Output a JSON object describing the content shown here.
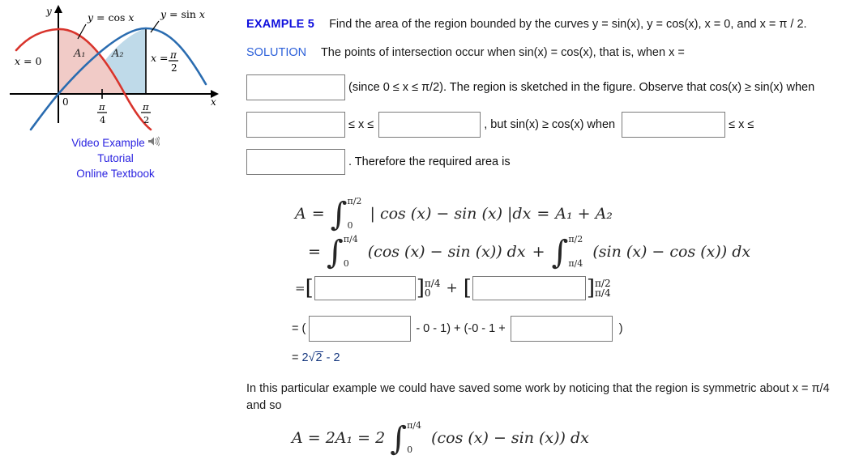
{
  "figure": {
    "axis_labels": {
      "y": "y",
      "x": "x",
      "origin": "0"
    },
    "tick_labels": [
      {
        "num": "π",
        "den": "4"
      },
      {
        "num": "π",
        "den": "2"
      }
    ],
    "curve_labels": [
      {
        "id": "cos-curve-label",
        "text": "y = cos x",
        "color": "#d8342c"
      },
      {
        "id": "sin-curve-label",
        "text": "y = sin x",
        "color": "#2a6cb0"
      }
    ],
    "region_labels": [
      {
        "id": "region-a1",
        "text": "A₁"
      },
      {
        "id": "region-a2",
        "text": "A₂"
      }
    ],
    "boundary_left": "x = 0",
    "boundary_right_lhs": "x =",
    "boundary_right_num": "π",
    "boundary_right_den": "2",
    "colors": {
      "cos_curve": "#d8342c",
      "sin_curve": "#2a6cb0",
      "region_a1_fill": "#f0c8c4",
      "region_a2_fill": "#bcd8e8",
      "axis": "#000000",
      "link": "#2a22e0"
    },
    "links": [
      {
        "id": "video-example",
        "label": "Video Example",
        "icon": "speaker-icon"
      },
      {
        "id": "tutorial",
        "label": "Tutorial",
        "icon": null
      },
      {
        "id": "online-textbook",
        "label": "Online Textbook",
        "icon": null
      }
    ]
  },
  "example": {
    "label": "EXAMPLE 5",
    "prompt": "Find the area of the region bounded by the curves y = sin(x), y = cos(x), x = 0, and x = π / 2."
  },
  "solution": {
    "label": "SOLUTION",
    "line1": "The points of intersection occur when sin(x) = cos(x), that is, when x =",
    "after_box1": "(since 0 ≤ x ≤ π/2). The region is sketched in the figure. Observe that cos(x) ≥ sin(x) when",
    "between_box2_box3": "≤ x ≤",
    "after_box3": ", but sin(x) ≥ cos(x) when",
    "after_box4": "≤ x ≤",
    "after_box5": ". Therefore the required area is"
  },
  "inputs": {
    "box1": {
      "name": "answer-box-1",
      "value": "",
      "placeholder": ""
    },
    "box2": {
      "name": "answer-box-2",
      "value": "",
      "placeholder": ""
    },
    "box3": {
      "name": "answer-box-3",
      "value": "",
      "placeholder": ""
    },
    "box4": {
      "name": "answer-box-4",
      "value": "",
      "placeholder": ""
    },
    "box5": {
      "name": "answer-box-5",
      "value": "",
      "placeholder": ""
    },
    "box6": {
      "name": "antiderivative-box-1",
      "value": "",
      "placeholder": ""
    },
    "box7": {
      "name": "antiderivative-box-2",
      "value": "",
      "placeholder": ""
    },
    "box8": {
      "name": "evaluation-box-1",
      "value": "",
      "placeholder": ""
    },
    "box9": {
      "name": "evaluation-box-2",
      "value": "",
      "placeholder": ""
    }
  },
  "math": {
    "eq1": {
      "lhs": "A",
      "eq": "=",
      "upper": "π/2",
      "lower": "0",
      "integrand": "| cos (x) − sin (x) |dx",
      "tail_eq": "=",
      "tail": "A₁ + A₂"
    },
    "eq2": {
      "eq": "=",
      "int1": {
        "upper": "π/4",
        "lower": "0",
        "integrand": "(cos (x) − sin (x)) dx"
      },
      "plus": "+",
      "int2": {
        "upper": "π/2",
        "lower": "π/4",
        "integrand": "(sin (x) − cos (x)) dx"
      }
    },
    "eq3": {
      "eq": "=",
      "open1": "[",
      "close1": "]",
      "lim1_top": "π/4",
      "lim1_bot": "0",
      "plus": "+",
      "open2": "[",
      "close2": "]",
      "lim2_top": "π/2",
      "lim2_bot": "π/4"
    },
    "eq4": {
      "eq": "= (",
      "mid": "- 0 - 1) + (-0 - 1 +",
      "close": ")"
    },
    "eq5": {
      "eq": "=",
      "coef": "2",
      "radicand": "2",
      "tail": "- 2"
    },
    "eq6": {
      "lhs": "A = 2A₁ = 2",
      "upper": "π/4",
      "lower": "0",
      "integrand": "(cos (x) − sin (x)) dx"
    }
  },
  "closing": {
    "text": "In this particular example we could have saved some work by noticing that the region is symmetric about x = π/4 and so"
  }
}
